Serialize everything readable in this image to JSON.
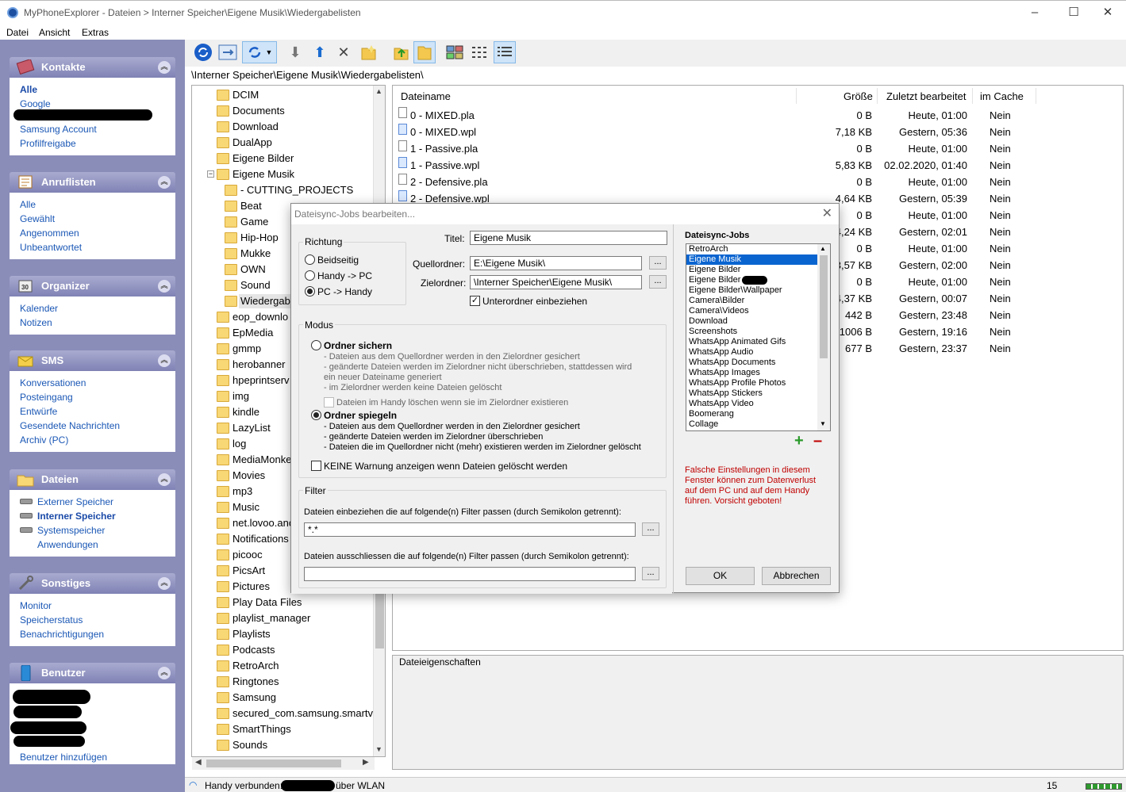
{
  "window": {
    "title": "MyPhoneExplorer  -  Dateien  >  Interner Speicher\\Eigene Musik\\Wiedergabelisten",
    "minimize": "–",
    "maximize": "☐",
    "close": "✕"
  },
  "menu": [
    "Datei",
    "Ansicht",
    "Extras"
  ],
  "sidebar": {
    "kontakte": {
      "title": "Kontakte",
      "items": [
        "Alle",
        "Google",
        "Samsung Account",
        "Profilfreigabe"
      ]
    },
    "anruflisten": {
      "title": "Anruflisten",
      "items": [
        "Alle",
        "Gewählt",
        "Angenommen",
        "Unbeantwortet"
      ]
    },
    "organizer": {
      "title": "Organizer",
      "items": [
        "Kalender",
        "Notizen"
      ]
    },
    "sms": {
      "title": "SMS",
      "items": [
        "Konversationen",
        "Posteingang",
        "Entwürfe",
        "Gesendete Nachrichten",
        "Archiv (PC)"
      ]
    },
    "dateien": {
      "title": "Dateien",
      "items": [
        "Externer Speicher",
        "Interner Speicher",
        "Systemspeicher",
        "Anwendungen"
      ]
    },
    "sonstiges": {
      "title": "Sonstiges",
      "items": [
        "Monitor",
        "Speicherstatus",
        "Benachrichtigungen"
      ]
    },
    "benutzer": {
      "title": "Benutzer",
      "items": [
        "Benutzer hinzufügen"
      ]
    }
  },
  "path": "\\Interner Speicher\\Eigene Musik\\Wiedergabelisten\\",
  "tree": {
    "top": [
      "DCIM",
      "Documents",
      "Download",
      "DualApp",
      "Eigene Bilder",
      "Eigene Musik"
    ],
    "sub": [
      "- CUTTING_PROJECTS",
      "Beat",
      "Game",
      "Hip-Hop",
      "Mukke",
      "OWN",
      "Sound",
      "Wiedergab"
    ],
    "rest": [
      "eop_downlo",
      "EpMedia",
      "gmmp",
      "herobanner",
      "hpeprintserv",
      "img",
      "kindle",
      "LazyList",
      "log",
      "MediaMonke",
      "Movies",
      "mp3",
      "Music",
      "net.lovoo.anc",
      "Notifications",
      "picooc",
      "PicsArt",
      "Pictures",
      "Play Data Files",
      "playlist_manager",
      "Playlists",
      "Podcasts",
      "RetroArch",
      "Ringtones",
      "Samsung",
      "secured_com.samsung.smartvi",
      "SmartThings",
      "Sounds"
    ]
  },
  "files": {
    "headers": [
      "Dateiname",
      "Größe",
      "Zuletzt bearbeitet",
      "im Cache"
    ],
    "rows": [
      [
        "0 - MIXED.pla",
        "0 B",
        "Heute, 01:00",
        "Nein"
      ],
      [
        "0 - MIXED.wpl",
        "7,18 KB",
        "Gestern, 05:36",
        "Nein"
      ],
      [
        "1 - Passive.pla",
        "0 B",
        "Heute, 01:00",
        "Nein"
      ],
      [
        "1 - Passive.wpl",
        "5,83 KB",
        "02.02.2020, 01:40",
        "Nein"
      ],
      [
        "2 - Defensive.pla",
        "0 B",
        "Heute, 01:00",
        "Nein"
      ],
      [
        "2 - Defensive.wpl",
        "4,64 KB",
        "Gestern, 05:39",
        "Nein"
      ],
      [
        "",
        "0 B",
        "Heute, 01:00",
        "Nein"
      ],
      [
        "",
        "4,24 KB",
        "Gestern, 02:01",
        "Nein"
      ],
      [
        "",
        "0 B",
        "Heute, 01:00",
        "Nein"
      ],
      [
        "",
        "3,57 KB",
        "Gestern, 02:00",
        "Nein"
      ],
      [
        "",
        "0 B",
        "Heute, 01:00",
        "Nein"
      ],
      [
        "",
        "4,37 KB",
        "Gestern, 00:07",
        "Nein"
      ],
      [
        "",
        "442 B",
        "Gestern, 23:48",
        "Nein"
      ],
      [
        "",
        "1006 B",
        "Gestern, 19:16",
        "Nein"
      ],
      [
        "",
        "677 B",
        "Gestern, 23:37",
        "Nein"
      ]
    ]
  },
  "props_title": "Dateieigenschaften",
  "status": {
    "connected": "Handy verbunden:",
    "via": "über WLAN",
    "count": "15"
  },
  "dialog": {
    "title": "Dateisync-Jobs bearbeiten...",
    "richtung": "Richtung",
    "r1": "Beidseitig",
    "r2": "Handy -> PC",
    "r3": "PC -> Handy",
    "titel_label": "Titel:",
    "titel": "Eigene Musik",
    "quelle_label": "Quellordner:",
    "quelle": "E:\\Eigene Musik\\",
    "ziel_label": "Zielordner:",
    "ziel": "\\Interner Speicher\\Eigene Musik\\",
    "dots": "...",
    "unterordner": "Unterordner einbeziehen",
    "modus": "Modus",
    "sichern": "Ordner sichern",
    "s1": "- Dateien aus dem Quellordner werden in den Zielordner gesichert",
    "s2": "- geänderte Dateien werden im Zielordner nicht überschrieben, stattdessen wird",
    "s3": "ein neuer Dateiname generiert",
    "s4": "- im Zielordner werden keine Dateien gelöscht",
    "s5": "Dateien im Handy löschen wenn sie im Zielordner existieren",
    "spiegeln": "Ordner spiegeln",
    "p1": "- Dateien aus dem Quellordner werden in den Zielordner gesichert",
    "p2": "- geänderte Dateien werden im Zielordner überschrieben",
    "p3": "- Dateien die im Quellordner nicht (mehr) existieren werden im Zielordner gelöscht",
    "keine": "KEINE Warnung anzeigen wenn Dateien gelöscht werden",
    "filter": "Filter",
    "include_label": "Dateien einbeziehen die auf folgende(n) Filter passen (durch Semikolon getrennt):",
    "include": "*.*",
    "exclude_label": "Dateien ausschliessen die auf folgende(n) Filter passen (durch Semikolon getrennt):",
    "jobs_label": "Dateisync-Jobs",
    "jobs": [
      "RetroArch",
      "Eigene Musik",
      "Eigene Bilder",
      "Eigene Bilder",
      "Eigene Bilder\\Wallpaper",
      "Camera\\Bilder",
      "Camera\\Videos",
      "Download",
      "Screenshots",
      "WhatsApp Animated Gifs",
      "WhatsApp Audio",
      "WhatsApp Documents",
      "WhatsApp Images",
      "WhatsApp Profile Photos",
      "WhatsApp Stickers",
      "WhatsApp Video",
      "Boomerang",
      "Collage"
    ],
    "warning": [
      "Falsche Einstellungen in diesem",
      "Fenster können zum Datenverlust",
      "auf dem PC und auf dem Handy",
      "führen. Vorsicht geboten!"
    ],
    "ok": "OK",
    "cancel": "Abbrechen",
    "add": "+",
    "remove": "–"
  },
  "colors": {
    "sidebar": "#8a8db8",
    "link": "#1a57b5",
    "selection": "#0a64d0",
    "warning": "#c00000"
  }
}
